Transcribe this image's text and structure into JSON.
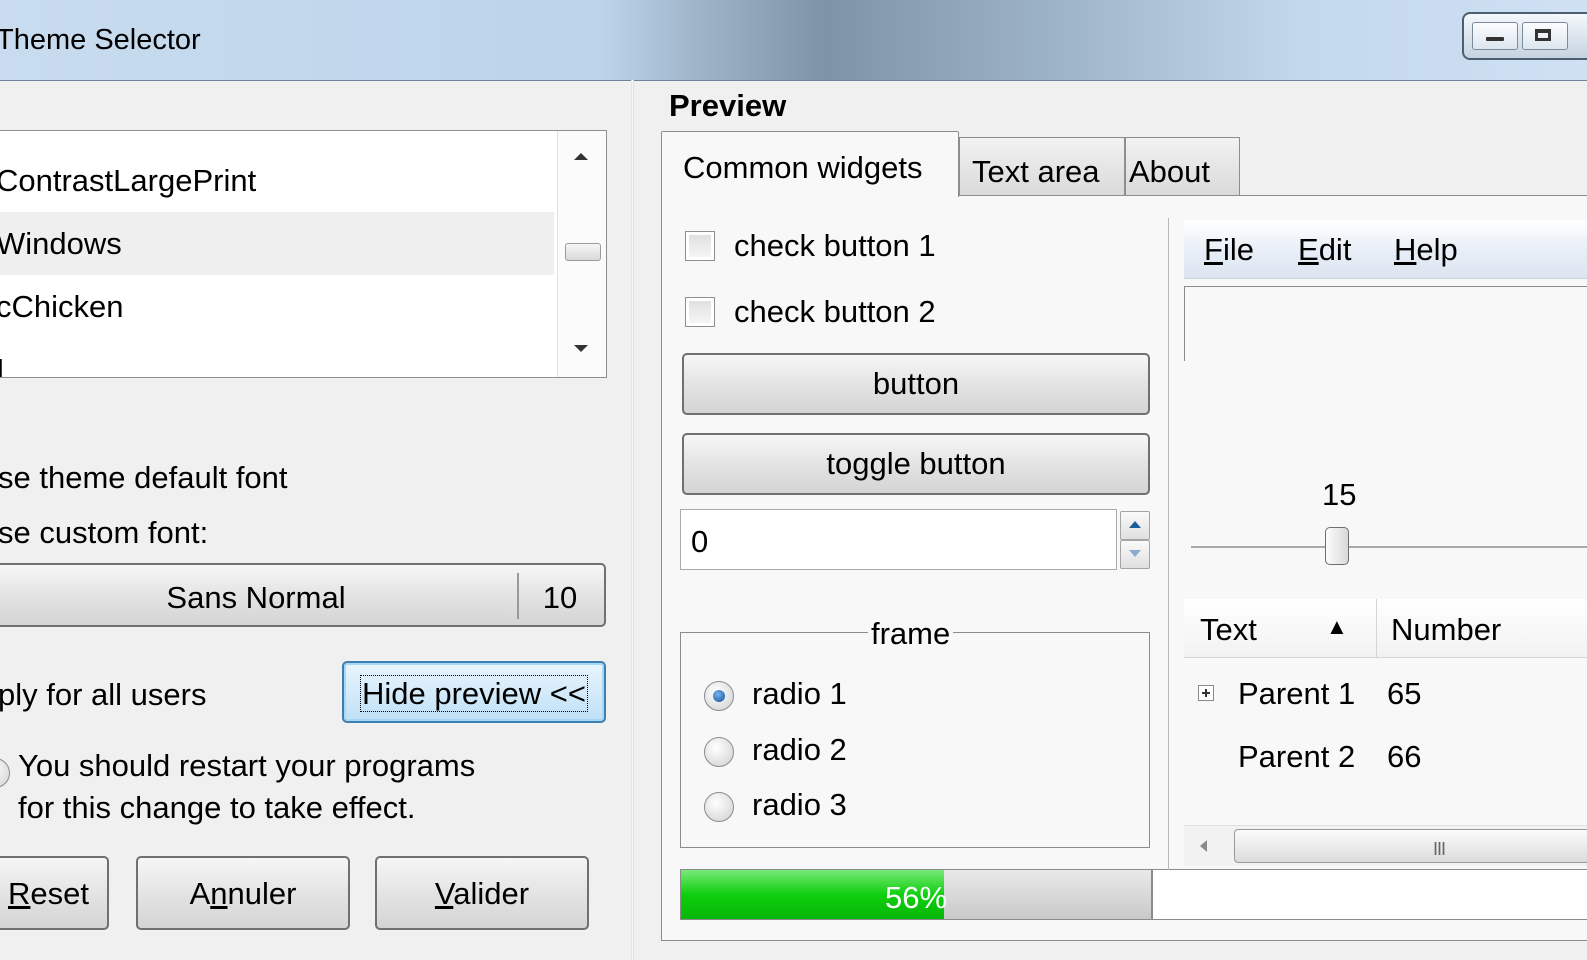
{
  "window": {
    "title": "Theme Selector"
  },
  "theme_list": {
    "items": [
      "ContrastLargePrint",
      "Windows",
      "cChicken",
      "I"
    ],
    "selected_index": 1
  },
  "font": {
    "default_option": "se theme default font",
    "custom_option": "se custom font:",
    "name": "Sans Normal",
    "size": "10"
  },
  "apply_all": "ply for all users",
  "hide_preview": "Hide preview <<",
  "restart_notice": {
    "line1": "You should restart your programs",
    "line2": "for this change to take effect."
  },
  "buttons": {
    "reset_underlined": "R",
    "reset_rest": "eset",
    "annuler_pre": "A",
    "annuler_underlined": "n",
    "annuler_rest": "nuler",
    "valider_underlined": "V",
    "valider_rest": "alider"
  },
  "preview": {
    "title": "Preview",
    "tabs": [
      "Common widgets",
      "Text area",
      "About"
    ],
    "active_tab": "Common widgets",
    "check1": "check button 1",
    "check2": "check button 2",
    "button": "button",
    "toggle_button": "toggle button",
    "spin_value": "0",
    "frame_label": "frame",
    "radios": [
      "radio 1",
      "radio 2",
      "radio 3"
    ],
    "radio_selected": 0,
    "progress_percent": 56,
    "progress_text": "56%",
    "menu": [
      {
        "underlined": "F",
        "rest": "ile"
      },
      {
        "underlined": "E",
        "rest": "dit"
      },
      {
        "underlined": "H",
        "rest": "elp"
      }
    ],
    "scale_value": "15",
    "tree": {
      "columns": [
        "Text",
        "Number"
      ],
      "rows": [
        {
          "text": "Parent 1",
          "number": "65",
          "expandable": true
        },
        {
          "text": "Parent 2",
          "number": "66",
          "expandable": false
        }
      ]
    },
    "hscroll_grip": "III"
  }
}
